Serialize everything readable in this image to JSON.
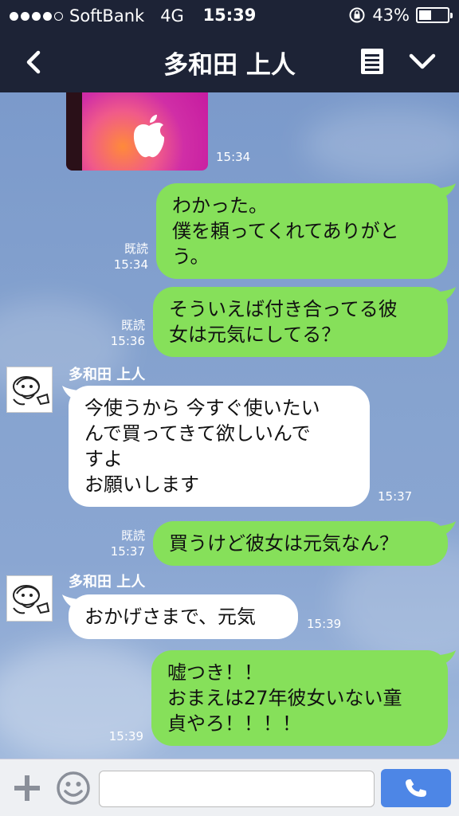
{
  "status": {
    "carrier": "SoftBank",
    "network": "4G",
    "time": "15:39",
    "battery": "43%",
    "battery_level": 0.43,
    "signal_dots": 5,
    "signal_filled": 4
  },
  "header": {
    "title": "多和田 上人"
  },
  "colors": {
    "bar": "#1d2336",
    "me_bubble": "#86e05a",
    "them_bubble": "#ffffff",
    "send_button": "#4d86e6"
  },
  "messages": [
    {
      "time": "15:34"
    },
    {
      "read": "既読",
      "time": "15:34",
      "lines": [
        "わかった。",
        "僕を頼ってくれてありがと",
        "う。"
      ]
    },
    {
      "read": "既読",
      "time": "15:36",
      "lines": [
        "そういえば付き合ってる彼",
        "女は元気にしてる？"
      ]
    },
    {
      "sender": "多和田 上人",
      "time": "15:37",
      "lines": [
        "今使うから 今すぐ使いたい",
        "んで買ってきて欲しいんで",
        "すよ",
        "お願いします"
      ]
    },
    {
      "read": "既読",
      "time": "15:37",
      "lines": [
        "買うけど彼女は元気なん？"
      ]
    },
    {
      "sender": "多和田 上人",
      "time": "15:39",
      "lines": [
        "おかげさまで、元気"
      ]
    },
    {
      "time": "15:39",
      "lines": [
        "嘘つき！！",
        "おまえは27年彼女いない童",
        "貞やろ！！！！"
      ]
    }
  ],
  "input": {
    "placeholder": ""
  },
  "icons": {
    "back": "chevron-left-icon",
    "menu": "note-icon",
    "dropdown": "chevron-down-icon",
    "add": "plus-icon",
    "sticker": "smiley-icon",
    "send": "phone-icon"
  }
}
